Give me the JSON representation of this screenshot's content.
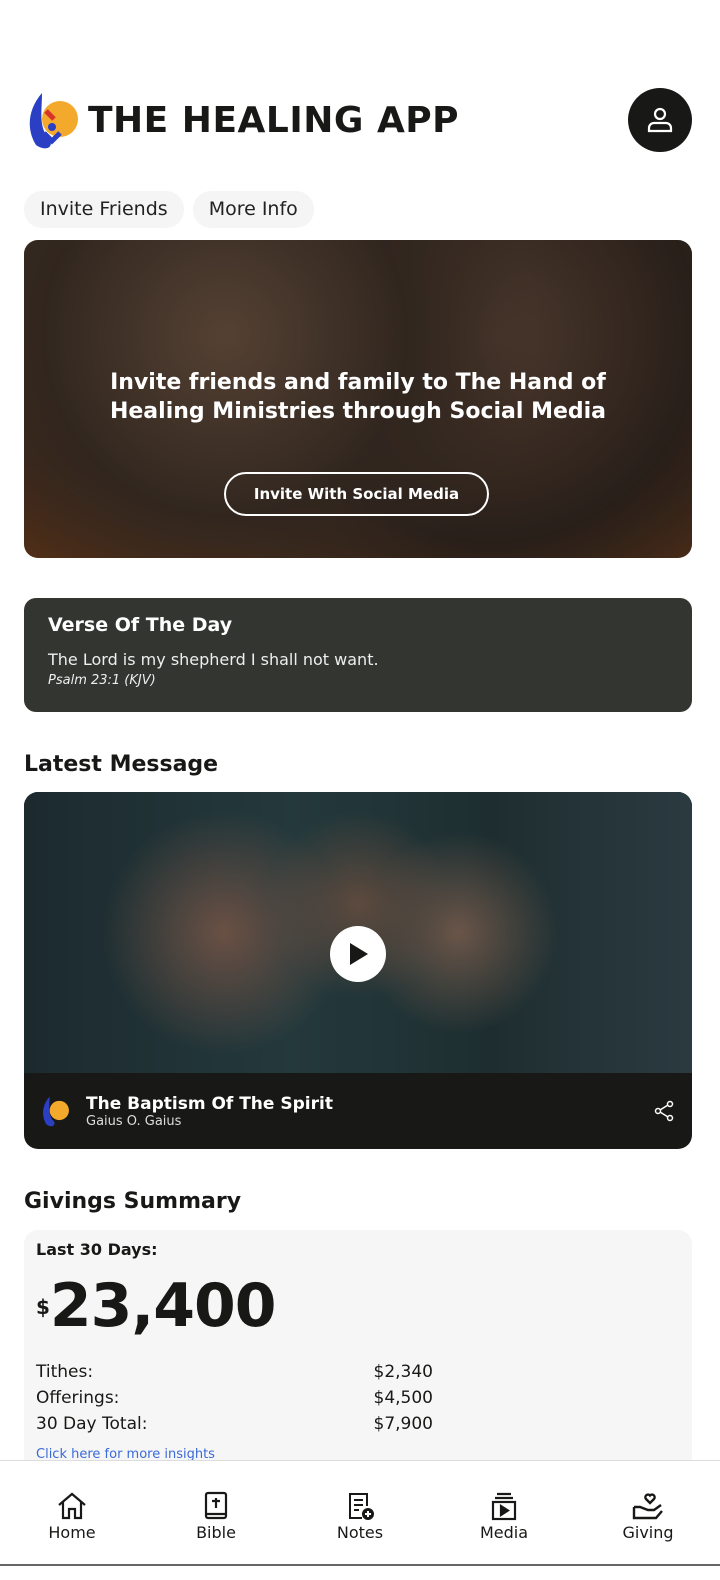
{
  "header": {
    "title": "THE HEALING APP",
    "logo": "flame-globe-logo",
    "profile_icon": "user-icon"
  },
  "chips": [
    {
      "label": "Invite Friends"
    },
    {
      "label": "More Info"
    }
  ],
  "hero": {
    "text": "Invite friends and family to The Hand of Healing Ministries through Social Media",
    "button": "Invite With Social Media"
  },
  "verse": {
    "title": "Verse Of The Day",
    "text": "The Lord is my shepherd I shall not want.",
    "reference": "Psalm 23:1 (KJV)"
  },
  "latest": {
    "heading": "Latest Message",
    "title": "The Baptism Of The Spirit",
    "author": "Gaius O. Gaius"
  },
  "givings": {
    "heading": "Givings Summary",
    "period": "Last 30 Days:",
    "currency": "$",
    "total": "23,400",
    "rows": [
      {
        "label": "Tithes:",
        "value": "$2,340"
      },
      {
        "label": "Offerings:",
        "value": "$4,500"
      },
      {
        "label": "30 Day Total:",
        "value": "$7,900"
      }
    ],
    "link": "Click here for more insights"
  },
  "nav": [
    {
      "label": "Home",
      "icon": "home-icon"
    },
    {
      "label": "Bible",
      "icon": "bible-icon"
    },
    {
      "label": "Notes",
      "icon": "notes-add-icon"
    },
    {
      "label": "Media",
      "icon": "media-icon"
    },
    {
      "label": "Giving",
      "icon": "giving-hand-icon"
    }
  ],
  "colors": {
    "dark": "#181917",
    "verse_bg": "#333531",
    "link": "#3a6ad8",
    "card_bg": "#f6f6f6"
  }
}
